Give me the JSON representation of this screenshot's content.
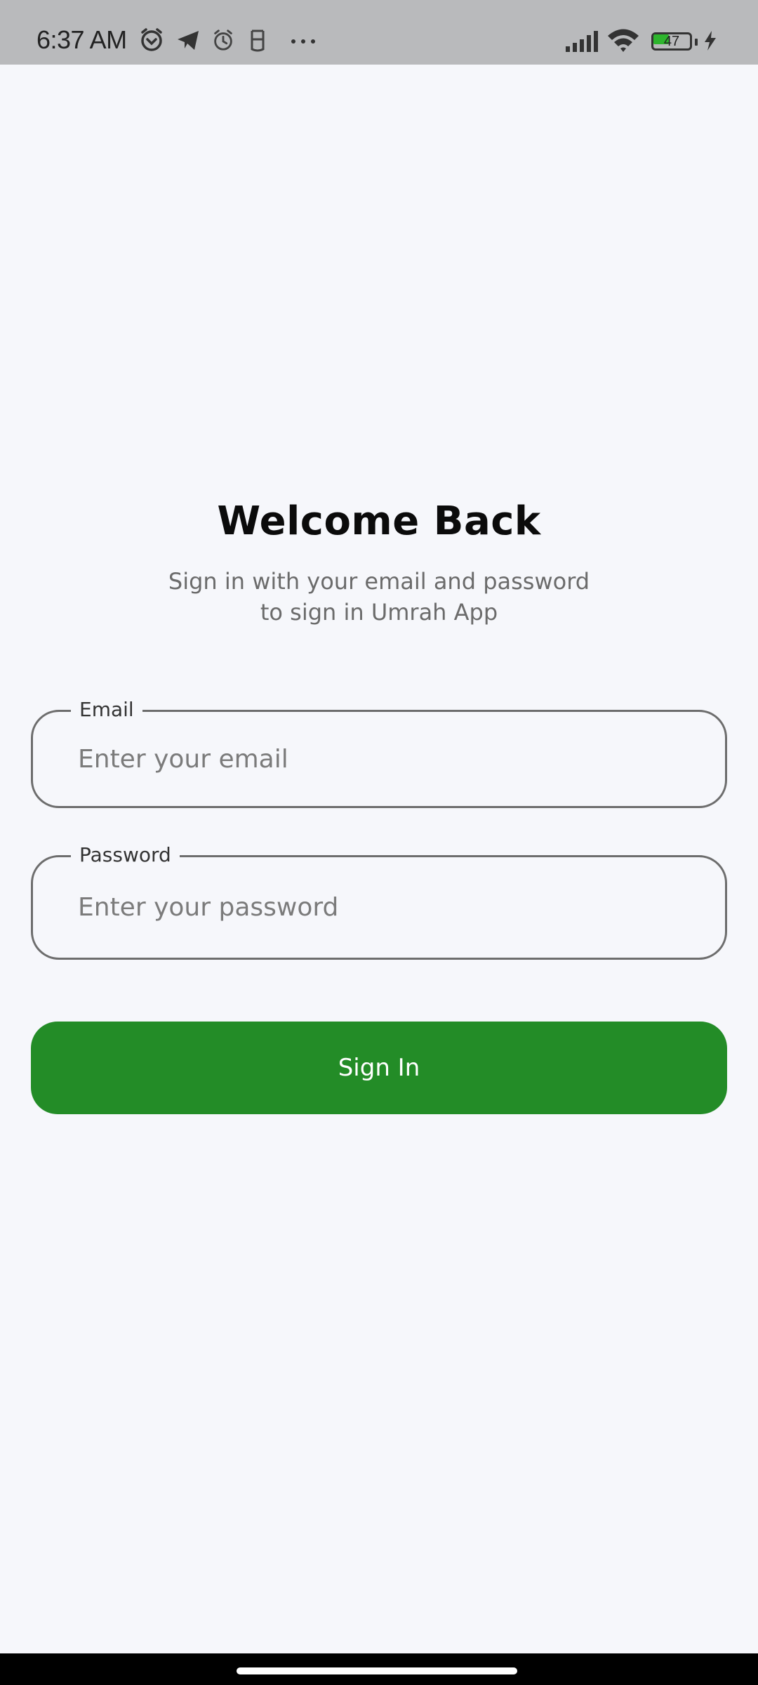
{
  "status_bar": {
    "time": "6:37 AM",
    "battery_level": "47",
    "icons": [
      "alarm-icon",
      "telegram-icon",
      "alarm-icon",
      "notification-icon",
      "more-icon",
      "signal-icon",
      "wifi-icon",
      "battery-icon",
      "charging-icon"
    ]
  },
  "login": {
    "title": "Welcome Back",
    "subtitle_line1": "Sign in with your email and password",
    "subtitle_line2": "to sign in Umrah App",
    "email": {
      "label": "Email",
      "placeholder": "Enter your email",
      "value": ""
    },
    "password": {
      "label": "Password",
      "placeholder": "Enter your password",
      "value": ""
    },
    "signin_label": "Sign In"
  },
  "colors": {
    "background": "#f6f7fb",
    "primary": "#238c27",
    "status_bar": "#b9babc"
  }
}
